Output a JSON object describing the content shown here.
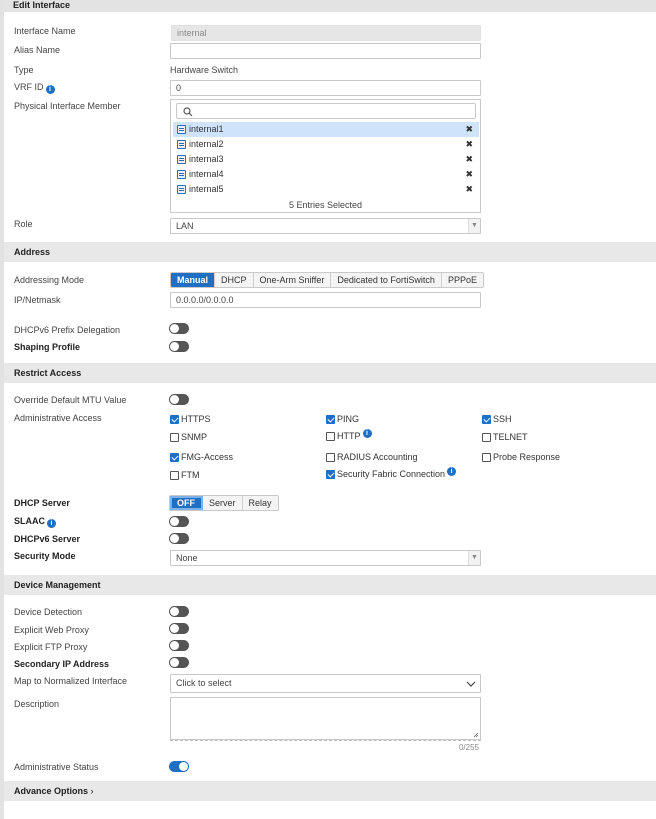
{
  "header": {
    "title": "Edit Interface"
  },
  "fields": {
    "interface_name": {
      "label": "Interface Name",
      "value": "internal"
    },
    "alias_name": {
      "label": "Alias Name",
      "value": ""
    },
    "type": {
      "label": "Type",
      "value": "Hardware Switch"
    },
    "vrf_id": {
      "label": "VRF ID",
      "value": "0"
    },
    "physical_member": {
      "label": "Physical Interface Member",
      "search_placeholder": "",
      "members": [
        "internal1",
        "internal2",
        "internal3",
        "internal4",
        "internal5"
      ],
      "selected_summary": "5 Entries Selected"
    },
    "role": {
      "label": "Role",
      "value": "LAN"
    }
  },
  "address": {
    "title": "Address",
    "addressing_mode_label": "Addressing Mode",
    "modes": [
      "Manual",
      "DHCP",
      "One-Arm Sniffer",
      "Dedicated to FortiSwitch",
      "PPPoE"
    ],
    "active_mode": "Manual",
    "ip_label": "IP/Netmask",
    "ip_value": "0.0.0.0/0.0.0.0",
    "dhcpv6_prefix_label": "DHCPv6 Prefix Delegation",
    "dhcpv6_prefix_enabled": false,
    "shaping_label": "Shaping Profile",
    "shaping_enabled": false
  },
  "restrict": {
    "title": "Restrict Access",
    "mtu_label": "Override Default MTU Value",
    "mtu_enabled": false,
    "admin_access_label": "Administrative Access",
    "options": [
      {
        "label": "HTTPS",
        "checked": true
      },
      {
        "label": "PING",
        "checked": true
      },
      {
        "label": "SSH",
        "checked": true
      },
      {
        "label": "SNMP",
        "checked": false
      },
      {
        "label": "HTTP",
        "checked": false
      },
      {
        "label": "TELNET",
        "checked": false
      },
      {
        "label": "FMG-Access",
        "checked": true
      },
      {
        "label": "RADIUS Accounting",
        "checked": false
      },
      {
        "label": "Probe Response",
        "checked": false
      },
      {
        "label": "FTM",
        "checked": false
      },
      {
        "label": "Security Fabric Connection",
        "checked": true
      }
    ]
  },
  "dhcp": {
    "server_label": "DHCP Server",
    "server_modes": [
      "OFF",
      "Server",
      "Relay"
    ],
    "server_active": "OFF",
    "slaac_label": "SLAAC",
    "slaac_enabled": false,
    "dhcpv6_label": "DHCPv6 Server",
    "dhcpv6_enabled": false,
    "security_mode_label": "Security Mode",
    "security_mode_value": "None"
  },
  "device": {
    "title": "Device Management",
    "detection_label": "Device Detection",
    "detection_enabled": false,
    "web_proxy_label": "Explicit Web Proxy",
    "web_proxy_enabled": false,
    "ftp_proxy_label": "Explicit FTP Proxy",
    "ftp_proxy_enabled": false,
    "secondary_ip_label": "Secondary IP Address",
    "secondary_ip_enabled": false,
    "map_label": "Map to Normalized Interface",
    "map_placeholder": "Click to select",
    "description_label": "Description",
    "description_value": "",
    "description_counter": "0/255",
    "admin_status_label": "Administrative Status",
    "admin_status_enabled": true
  },
  "advance": {
    "title": "Advance Options"
  },
  "colors": {
    "accent": "#1f6fc5",
    "section_bg": "#e8e8e8",
    "selected_row": "#cfe3fa"
  }
}
